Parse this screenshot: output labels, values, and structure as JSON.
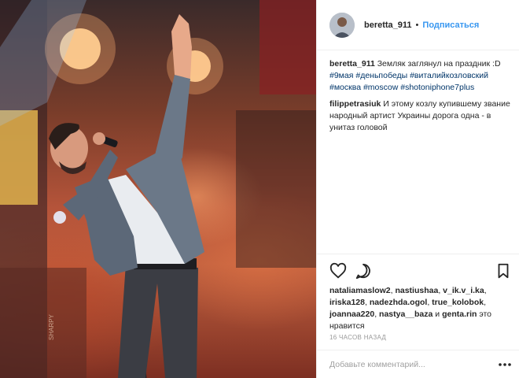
{
  "header": {
    "username": "beretta_911",
    "separator": "•",
    "follow_label": "Подписаться"
  },
  "caption": {
    "author": "beretta_911",
    "text": " Земляк заглянул на праздник :D",
    "tags": [
      "#9мая",
      "#деньпобеды",
      "#виталийкозловский",
      "#москва",
      "#moscow",
      "#shotoniphone7plus"
    ]
  },
  "comments": [
    {
      "author": "filippetrasiuk",
      "text": " И этому козлу купившему звание народный артист Украины дорога одна - в унитаз головой"
    }
  ],
  "actions": {
    "like_icon": "heart-icon",
    "comment_icon": "comment-bubble-icon",
    "bookmark_icon": "bookmark-icon"
  },
  "likes": {
    "users": [
      "nataliamaslow2",
      "nastiushaa",
      "v_ik.v_i.ka",
      "iriska128",
      "nadezhda.ogol",
      "true_kolobok",
      "joannaa220",
      "nastya__baza"
    ],
    "and_word": "и",
    "last_user": "genta.rin",
    "suffix": "это нравится"
  },
  "timestamp": "16 часов назад",
  "add_comment": {
    "placeholder": "Добавьте комментарий..."
  },
  "photo": {
    "stage_sign": "SHARPY"
  },
  "colors": {
    "link_blue": "#3897f0",
    "hashtag": "#003569",
    "border": "#efefef",
    "muted": "#999999"
  }
}
